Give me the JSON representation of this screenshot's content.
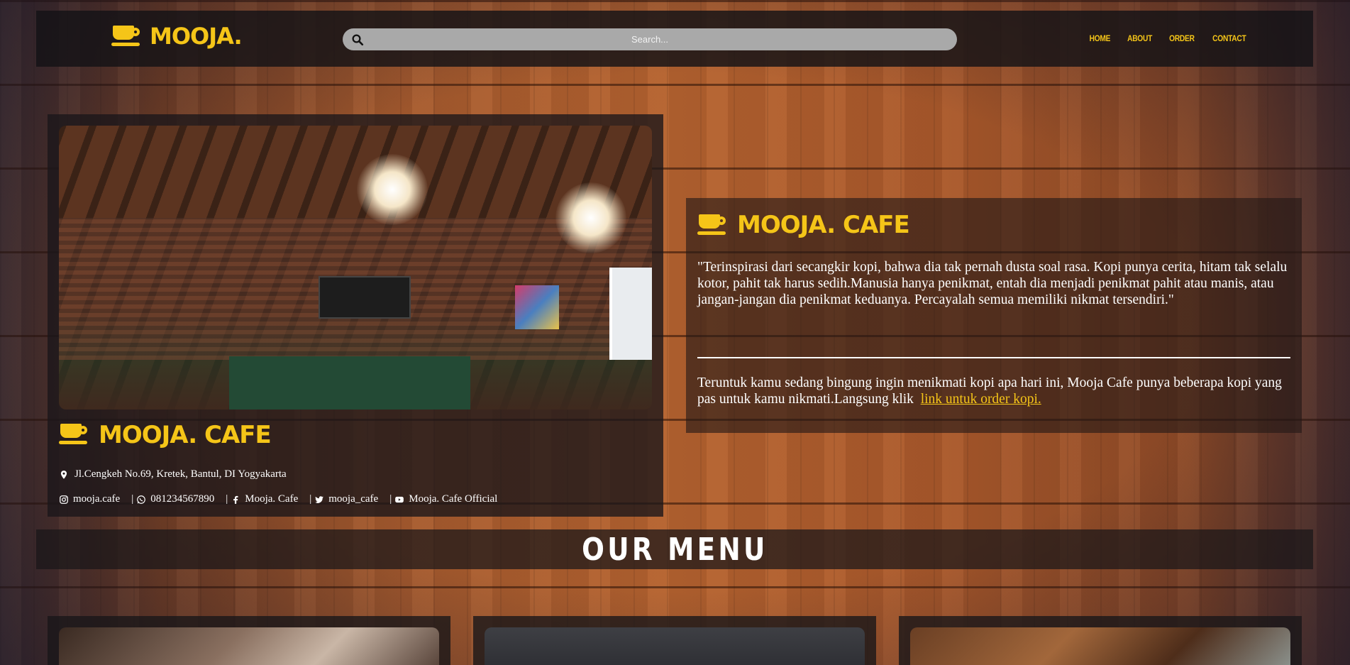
{
  "header": {
    "brand": "MOOJA.",
    "search_placeholder": "Search...",
    "nav": [
      "HOME",
      "ABOUT",
      "ORDER",
      "CONTACT"
    ]
  },
  "cafe": {
    "title": "MOOJA. CAFE",
    "address": "Jl.Cengkeh No.69, Kretek, Bantul, DI Yogyakarta",
    "socials": [
      {
        "icon": "instagram-icon",
        "label": "mooja.cafe"
      },
      {
        "icon": "whatsapp-icon",
        "label": "081234567890"
      },
      {
        "icon": "facebook-icon",
        "label": "Mooja. Cafe"
      },
      {
        "icon": "twitter-icon",
        "label": "mooja_cafe"
      },
      {
        "icon": "youtube-icon",
        "label": "Mooja. Cafe Official"
      }
    ],
    "separator": "|"
  },
  "about": {
    "title": "MOOJA. CAFE",
    "quote": "\"Terinspirasi dari secangkir kopi, bahwa dia tak pernah dusta soal rasa. Kopi punya cerita, hitam tak selalu kotor, pahit tak harus sedih.Manusia hanya penikmat, entah dia menjadi penikmat pahit atau manis, atau jangan-jangan dia penikmat keduanya. Percayalah semua memiliki nikmat tersendiri.\"",
    "desc": "Teruntuk kamu sedang bingung ingin menikmati kopi apa hari ini, Mooja Cafe punya beberapa kopi yang pas untuk kamu nikmati.Langsung klik",
    "link": "link untuk order kopi."
  },
  "menu": {
    "heading": "OUR MENU"
  },
  "colors": {
    "accent": "#f5c518",
    "panel": "#19161a"
  }
}
